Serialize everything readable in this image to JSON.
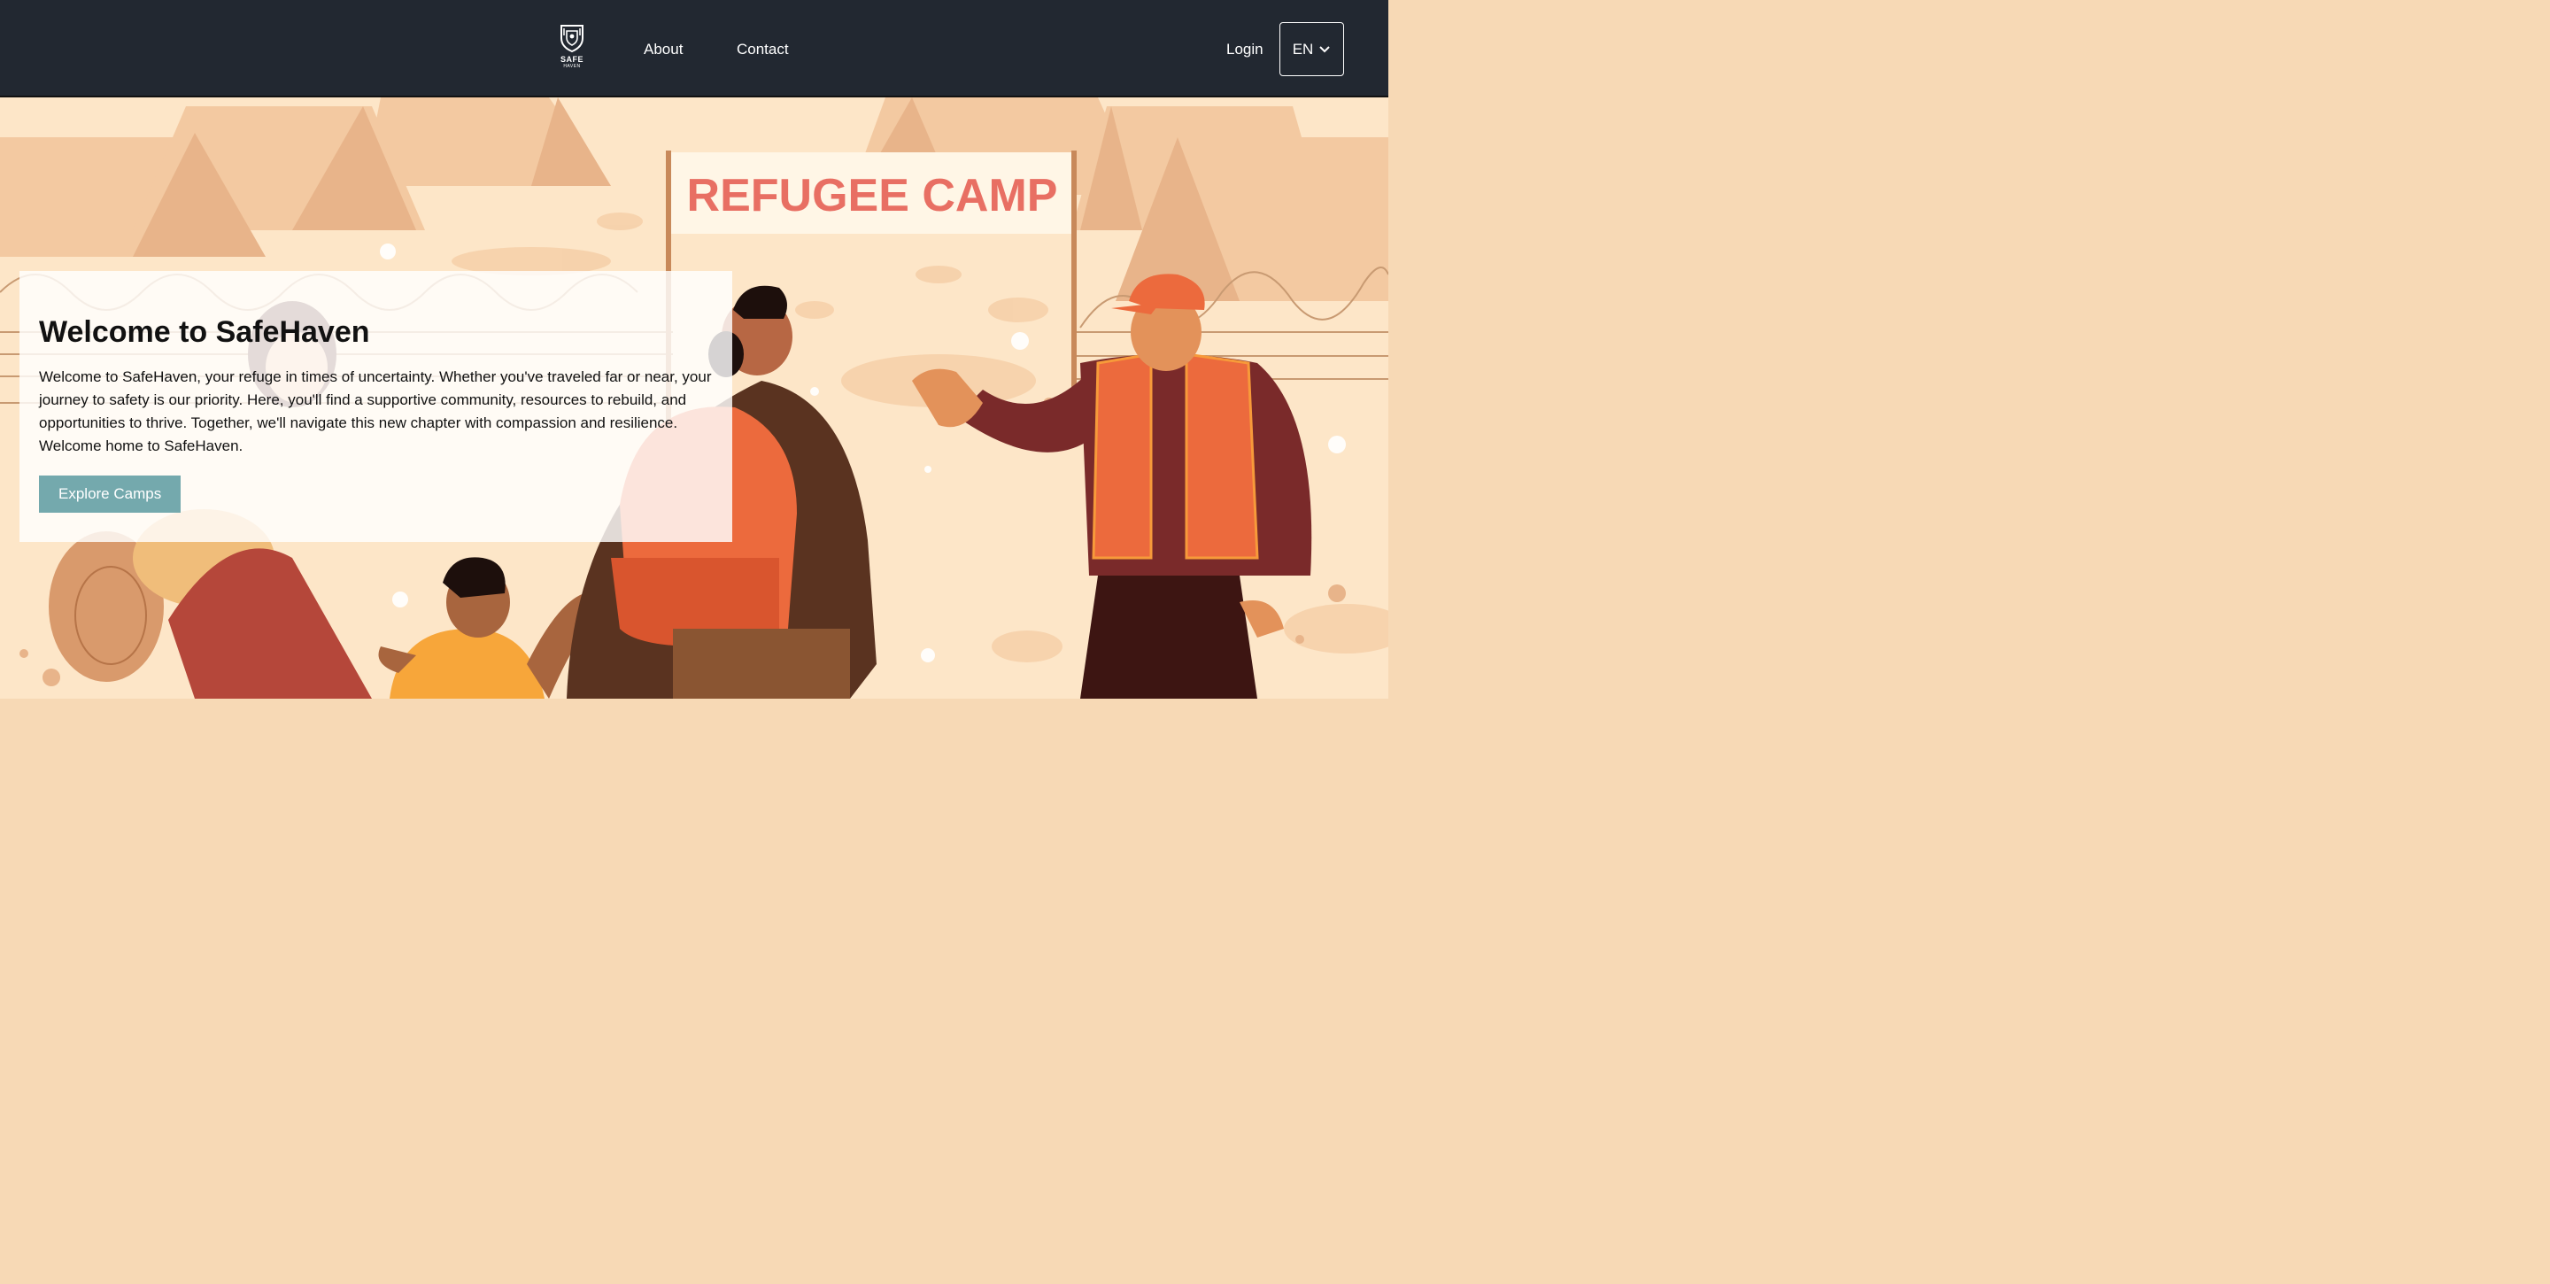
{
  "nav": {
    "logo_line1": "SAFE",
    "logo_line2": "HAVEN",
    "about_label": "About",
    "contact_label": "Contact",
    "login_label": "Login",
    "language": "EN"
  },
  "hero": {
    "sign_text": "REFUGEE CAMP",
    "title": "Welcome to SafeHaven",
    "body": "Welcome to SafeHaven, your refuge in times of uncertainty. Whether you've traveled far or near, your journey to safety is our priority. Here, you'll find a supportive community, resources to rebuild, and opportunities to thrive. Together, we'll navigate this new chapter with compassion and resilience. Welcome home to SafeHaven.",
    "cta_label": "Explore Camps"
  },
  "colors": {
    "nav_bg": "#222831",
    "cta_bg": "#74a9ad",
    "sign_text": "#e86f63",
    "sky": "#fde6c8"
  },
  "icons": {
    "logo": "shield-logo-icon",
    "language_caret": "chevron-down-icon"
  }
}
